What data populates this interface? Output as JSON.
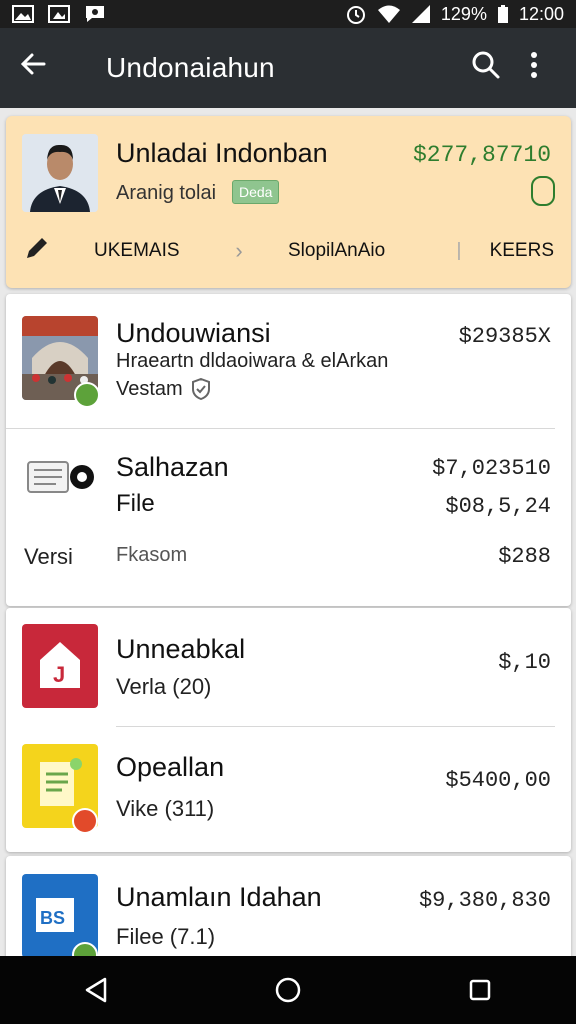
{
  "status_bar": {
    "battery_percent": "129%",
    "time": "12:00"
  },
  "app_bar": {
    "title": "Undonaiahun"
  },
  "profile": {
    "name": "Unladai Indonban",
    "subtitle": "Aranig tolai",
    "badge": "Deda",
    "amount": "$277,87710",
    "tabs": [
      "UKEMAIS",
      "SlopilAnAio",
      "KEERS"
    ]
  },
  "items": [
    {
      "title": "Undouwiansi",
      "line1": "Hraeartn dldaoiwara & elArkan",
      "line2": "Vestam",
      "amount": "$29385X"
    },
    {
      "title": "Salhazan",
      "line1": "File",
      "amount": "$7,023510",
      "amount2": "$08,5,24",
      "footer_left": "Versi",
      "footer_mid": "Fkasom",
      "footer_amount": "$288"
    },
    {
      "title": "Unneabkal",
      "line1": "Verla  (20)",
      "amount": "$,10"
    },
    {
      "title": "Opeallan",
      "line1": "Vike   (311)",
      "amount": "$5400,00"
    },
    {
      "title": "Unamlaın Idahan",
      "line1": "Filee  (7.1)",
      "amount": "$9,380,830"
    }
  ],
  "colors": {
    "appbar": "#2b2f33",
    "profile_bg": "#fde2b4",
    "accent_green": "#2e7d2e"
  }
}
